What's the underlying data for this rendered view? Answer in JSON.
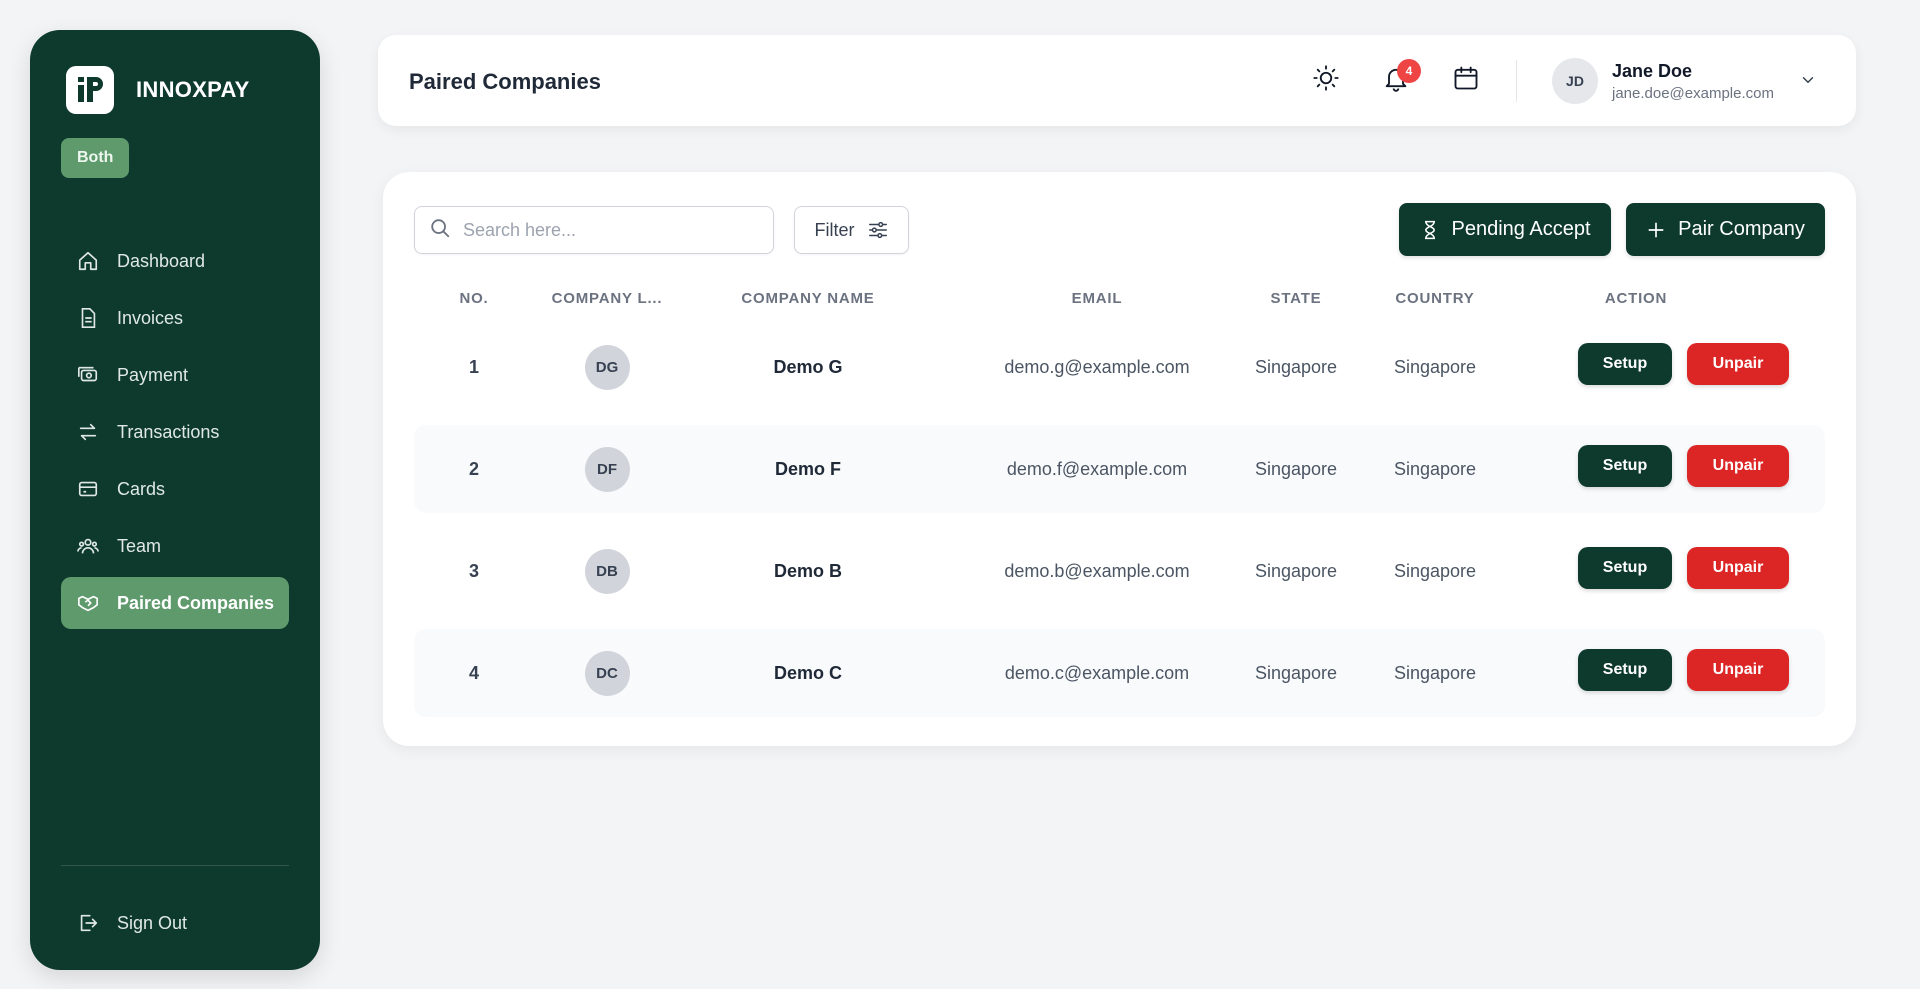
{
  "brand": {
    "name": "INNOXPAY",
    "logo_text": "iP"
  },
  "role_badge": "Both",
  "nav": [
    {
      "label": "Dashboard",
      "icon": "home-icon",
      "active": false
    },
    {
      "label": "Invoices",
      "icon": "document-icon",
      "active": false
    },
    {
      "label": "Payment",
      "icon": "money-icon",
      "active": false
    },
    {
      "label": "Transactions",
      "icon": "swap-arrows-icon",
      "active": false
    },
    {
      "label": "Cards",
      "icon": "card-icon",
      "active": false
    },
    {
      "label": "Team",
      "icon": "users-icon",
      "active": false
    },
    {
      "label": "Paired Companies",
      "icon": "handshake-icon",
      "active": true
    }
  ],
  "sign_out": "Sign Out",
  "header": {
    "title": "Paired Companies",
    "notification_count": "4",
    "user": {
      "initials": "JD",
      "name": "Jane Doe",
      "email": "jane.doe@example.com"
    }
  },
  "toolbar": {
    "search_placeholder": "Search here...",
    "filter_label": "Filter",
    "pending_label": "Pending Accept",
    "pair_label": "Pair Company"
  },
  "table": {
    "columns": [
      "NO.",
      "COMPANY L...",
      "COMPANY NAME",
      "EMAIL",
      "STATE",
      "COUNTRY",
      "ACTION"
    ],
    "rows": [
      {
        "no": "1",
        "logo": "DG",
        "name": "Demo G",
        "email": "demo.g@example.com",
        "state": "Singapore",
        "country": "Singapore"
      },
      {
        "no": "2",
        "logo": "DF",
        "name": "Demo F",
        "email": "demo.f@example.com",
        "state": "Singapore",
        "country": "Singapore"
      },
      {
        "no": "3",
        "logo": "DB",
        "name": "Demo B",
        "email": "demo.b@example.com",
        "state": "Singapore",
        "country": "Singapore"
      },
      {
        "no": "4",
        "logo": "DC",
        "name": "Demo C",
        "email": "demo.c@example.com",
        "state": "Singapore",
        "country": "Singapore"
      }
    ],
    "setup_label": "Setup",
    "unpair_label": "Unpair"
  },
  "colors": {
    "brand_dark": "#0e3a2e",
    "accent_green": "#5e9a6c",
    "danger": "#dc2626"
  }
}
